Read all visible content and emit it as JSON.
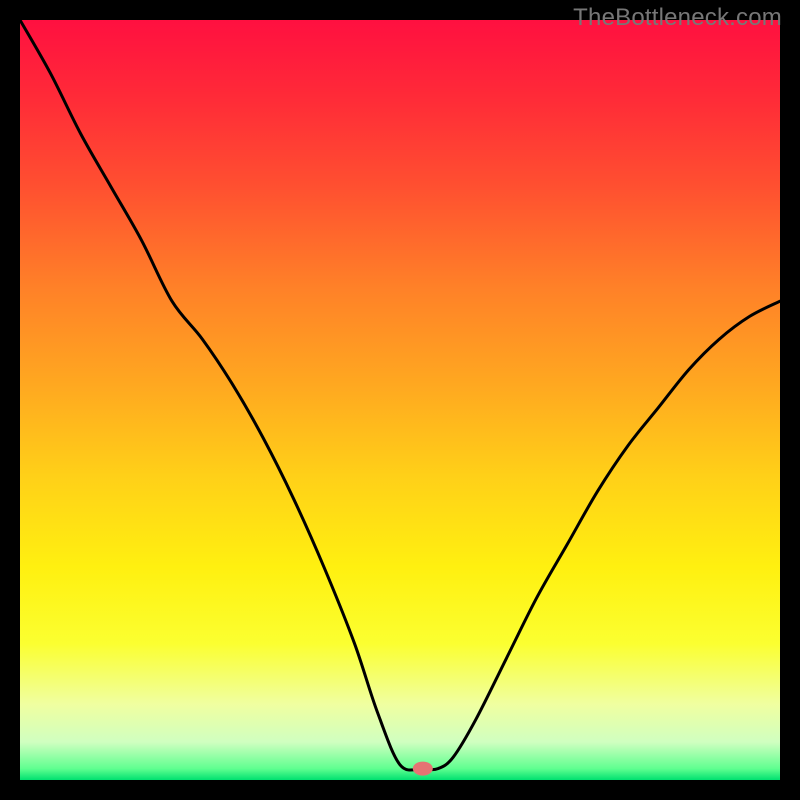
{
  "watermark": "TheBottleneck.com",
  "gradient": {
    "stops": [
      {
        "offset": 0.0,
        "color": "#ff1040"
      },
      {
        "offset": 0.1,
        "color": "#ff2a38"
      },
      {
        "offset": 0.22,
        "color": "#ff5030"
      },
      {
        "offset": 0.35,
        "color": "#ff8028"
      },
      {
        "offset": 0.48,
        "color": "#ffa820"
      },
      {
        "offset": 0.6,
        "color": "#ffd018"
      },
      {
        "offset": 0.72,
        "color": "#fff010"
      },
      {
        "offset": 0.82,
        "color": "#fbff30"
      },
      {
        "offset": 0.9,
        "color": "#f0ffa0"
      },
      {
        "offset": 0.95,
        "color": "#d0ffc0"
      },
      {
        "offset": 0.985,
        "color": "#60ff90"
      },
      {
        "offset": 1.0,
        "color": "#00e070"
      }
    ]
  },
  "marker": {
    "x_norm": 0.53,
    "y_norm": 0.985,
    "color": "#e57373",
    "rx": 10,
    "ry": 7
  },
  "chart_data": {
    "type": "line",
    "title": "",
    "xlabel": "",
    "ylabel": "",
    "xlim": [
      0,
      1
    ],
    "ylim": [
      0,
      1
    ],
    "series": [
      {
        "name": "curve",
        "x": [
          0.0,
          0.04,
          0.08,
          0.12,
          0.16,
          0.2,
          0.24,
          0.28,
          0.32,
          0.36,
          0.4,
          0.44,
          0.47,
          0.5,
          0.53,
          0.55,
          0.57,
          0.6,
          0.64,
          0.68,
          0.72,
          0.76,
          0.8,
          0.84,
          0.88,
          0.92,
          0.96,
          1.0
        ],
        "y": [
          1.0,
          0.93,
          0.85,
          0.78,
          0.71,
          0.63,
          0.58,
          0.52,
          0.45,
          0.37,
          0.28,
          0.18,
          0.09,
          0.02,
          0.015,
          0.015,
          0.03,
          0.08,
          0.16,
          0.24,
          0.31,
          0.38,
          0.44,
          0.49,
          0.54,
          0.58,
          0.61,
          0.63
        ]
      }
    ],
    "marker_point": {
      "x": 0.53,
      "y": 0.015
    }
  }
}
